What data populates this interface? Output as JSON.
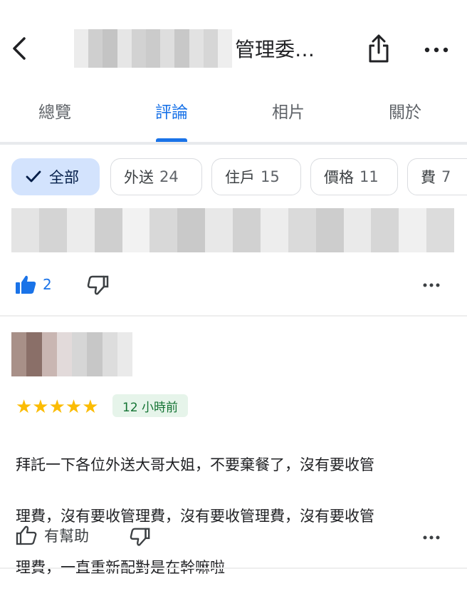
{
  "header": {
    "title": "管理委…",
    "back_icon": "arrow-back-icon",
    "share_icon": "share-icon",
    "more_icon": "more-horiz-icon"
  },
  "tabs": [
    {
      "label": "總覽",
      "active": false
    },
    {
      "label": "評論",
      "active": true
    },
    {
      "label": "相片",
      "active": false
    },
    {
      "label": "關於",
      "active": false
    }
  ],
  "filters": [
    {
      "label": "全部",
      "count": "",
      "selected": true
    },
    {
      "label": "外送",
      "count": "24",
      "selected": false
    },
    {
      "label": "住戶",
      "count": "15",
      "selected": false
    },
    {
      "label": "價格",
      "count": "11",
      "selected": false
    },
    {
      "label": "費",
      "count": "7",
      "selected": false
    }
  ],
  "previous_review": {
    "like_count": "2"
  },
  "review": {
    "rating": 5,
    "stars": "★★★★★",
    "time": "12 小時前",
    "lines": [
      "拜託一下各位外送大哥大姐，不要棄餐了，沒有要收管",
      "理費，沒有要收管理費，沒有要收管理費，沒有要收管",
      "理費，一直重新配對是在幹嘛啦"
    ],
    "helpful_label": "有幫助"
  },
  "colors": {
    "accent": "#1a73e8",
    "star": "#fbbc04",
    "chip_selected_bg": "#d3e3fd",
    "time_badge_bg": "#e6f4ea",
    "time_badge_text": "#137333"
  }
}
